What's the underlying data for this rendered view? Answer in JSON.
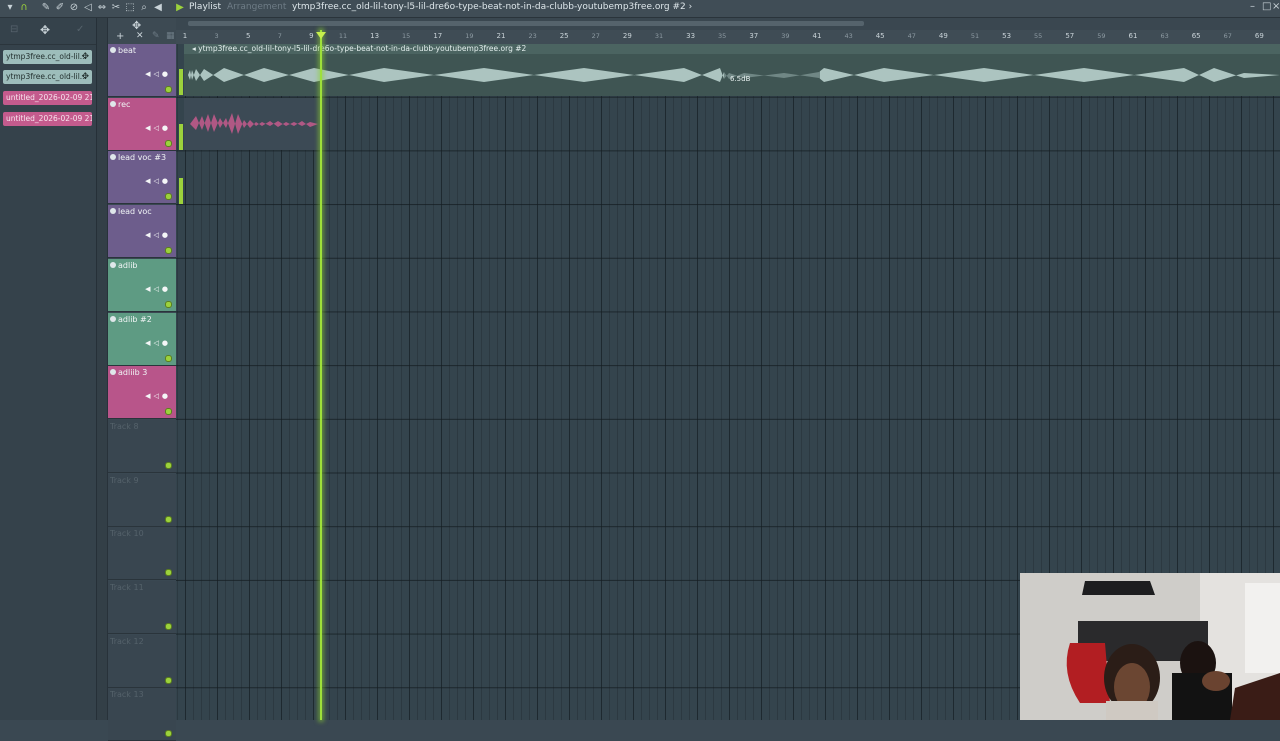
{
  "window": {
    "panel_title": "Playlist",
    "panel_subtitle": "Arrangement",
    "pattern_title": "ytmp3free.cc_old-lil-tony-l5-lil-dre6o-type-beat-not-in-da-clubb-youtubemp3free.org #2",
    "title_arrow": "›"
  },
  "toolbar_icons": [
    "magnet-icon",
    "pencil-icon",
    "paint-icon",
    "delete-icon",
    "mute-icon",
    "slip-icon",
    "slice-icon",
    "select-icon",
    "zoom-icon",
    "play-icon"
  ],
  "picker": {
    "items": [
      {
        "label": "ytmp3free.cc_old-lil...",
        "kind": "audio"
      },
      {
        "label": "ytmp3free.cc_old-lil...",
        "kind": "audio"
      },
      {
        "label": "untitled_2026-02-09 21-...",
        "kind": "rec"
      },
      {
        "label": "untitled_2026-02-09 21-...",
        "kind": "rec"
      }
    ]
  },
  "ruler": {
    "ticks": [
      "1",
      "3",
      "5",
      "7",
      "9",
      "11",
      "13",
      "15",
      "17",
      "19",
      "21",
      "23",
      "25",
      "27",
      "29",
      "31",
      "33",
      "35",
      "37",
      "39",
      "41",
      "43",
      "45",
      "47",
      "49",
      "51",
      "53",
      "55",
      "57",
      "59",
      "61",
      "63",
      "65",
      "67",
      "69"
    ]
  },
  "tracks": [
    {
      "name": "beat",
      "color": "#6d5d8c"
    },
    {
      "name": "rec",
      "color": "#b8558a"
    },
    {
      "name": "lead voc #3",
      "color": "#6d5d8c"
    },
    {
      "name": "lead voc",
      "color": "#6d5d8c"
    },
    {
      "name": "adlib",
      "color": "#5e9b83"
    },
    {
      "name": "adlib #2",
      "color": "#5e9b83"
    },
    {
      "name": "adliib 3",
      "color": "#b8558a"
    },
    {
      "name": "Track 8",
      "color": ""
    },
    {
      "name": "Track 9",
      "color": ""
    },
    {
      "name": "Track 10",
      "color": ""
    },
    {
      "name": "Track 11",
      "color": ""
    },
    {
      "name": "Track 12",
      "color": ""
    },
    {
      "name": "Track 13",
      "color": ""
    }
  ],
  "clips": {
    "beat_clip_title": "ytmp3free.cc_old-lil-tony-l5-lil-dre6o-type-beat-not-in-da-clubb-youtubemp3free.org #2",
    "gain_label": "6.5dB"
  },
  "colors": {
    "accent_green": "#9ee03a",
    "audio_clip": "#9dbdbb",
    "rec_clip": "#c45b8d"
  }
}
